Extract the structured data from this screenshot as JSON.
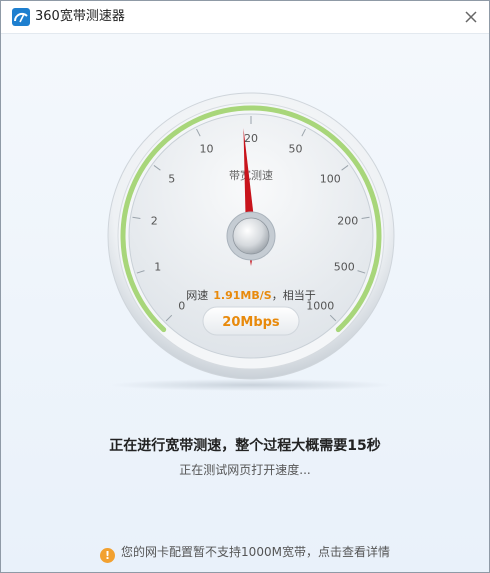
{
  "window": {
    "title": "360宽带测速器"
  },
  "gauge": {
    "center_label": "带宽测速",
    "ticks": [
      "0",
      "1",
      "2",
      "5",
      "10",
      "20",
      "50",
      "100",
      "200",
      "500",
      "1000"
    ],
    "speed_prefix": "网速",
    "speed_value": "1.91MB/S",
    "speed_suffix": "，相当于",
    "mbps_value": "20Mbps",
    "needle_reading": 20,
    "colors": {
      "arc_green": "#a8d67a",
      "needle_red": "#c8141c",
      "speed_orange": "#e88a0c"
    }
  },
  "status": {
    "main": "正在进行宽带测速，整个过程大概需要15秒",
    "sub": "正在测试网页打开速度..."
  },
  "notice": {
    "icon": "!",
    "text": "您的网卡配置暂不支持1000M宽带，点击查看详情"
  }
}
